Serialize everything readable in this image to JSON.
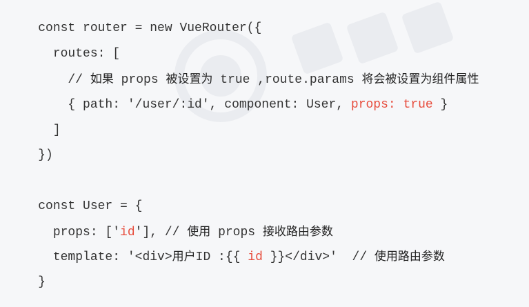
{
  "code": {
    "lines": [
      [
        "const router = new VueRouter({"
      ],
      [
        "  routes: ["
      ],
      [
        "    // ",
        "如果",
        " props ",
        "被设置为",
        " true ,route.params ",
        "将会被设置为组件属性"
      ],
      [
        "    { path: '/user/:id', component: User, ",
        "props: true",
        " }"
      ],
      [
        "  ]"
      ],
      [
        "})"
      ],
      [
        ""
      ],
      [
        "const User = {"
      ],
      [
        "  props: ['",
        "id",
        "'], // ",
        "使用",
        " props ",
        "接收路由参数"
      ],
      [
        "  template: '<div>",
        "用户",
        "ID :{{ ",
        "id",
        " }}</div>'  // ",
        "使用路由参数"
      ],
      [
        "}"
      ]
    ]
  },
  "colors": {
    "background": "#f6f7f9",
    "text": "#333333",
    "highlight": "#e74c3c"
  }
}
